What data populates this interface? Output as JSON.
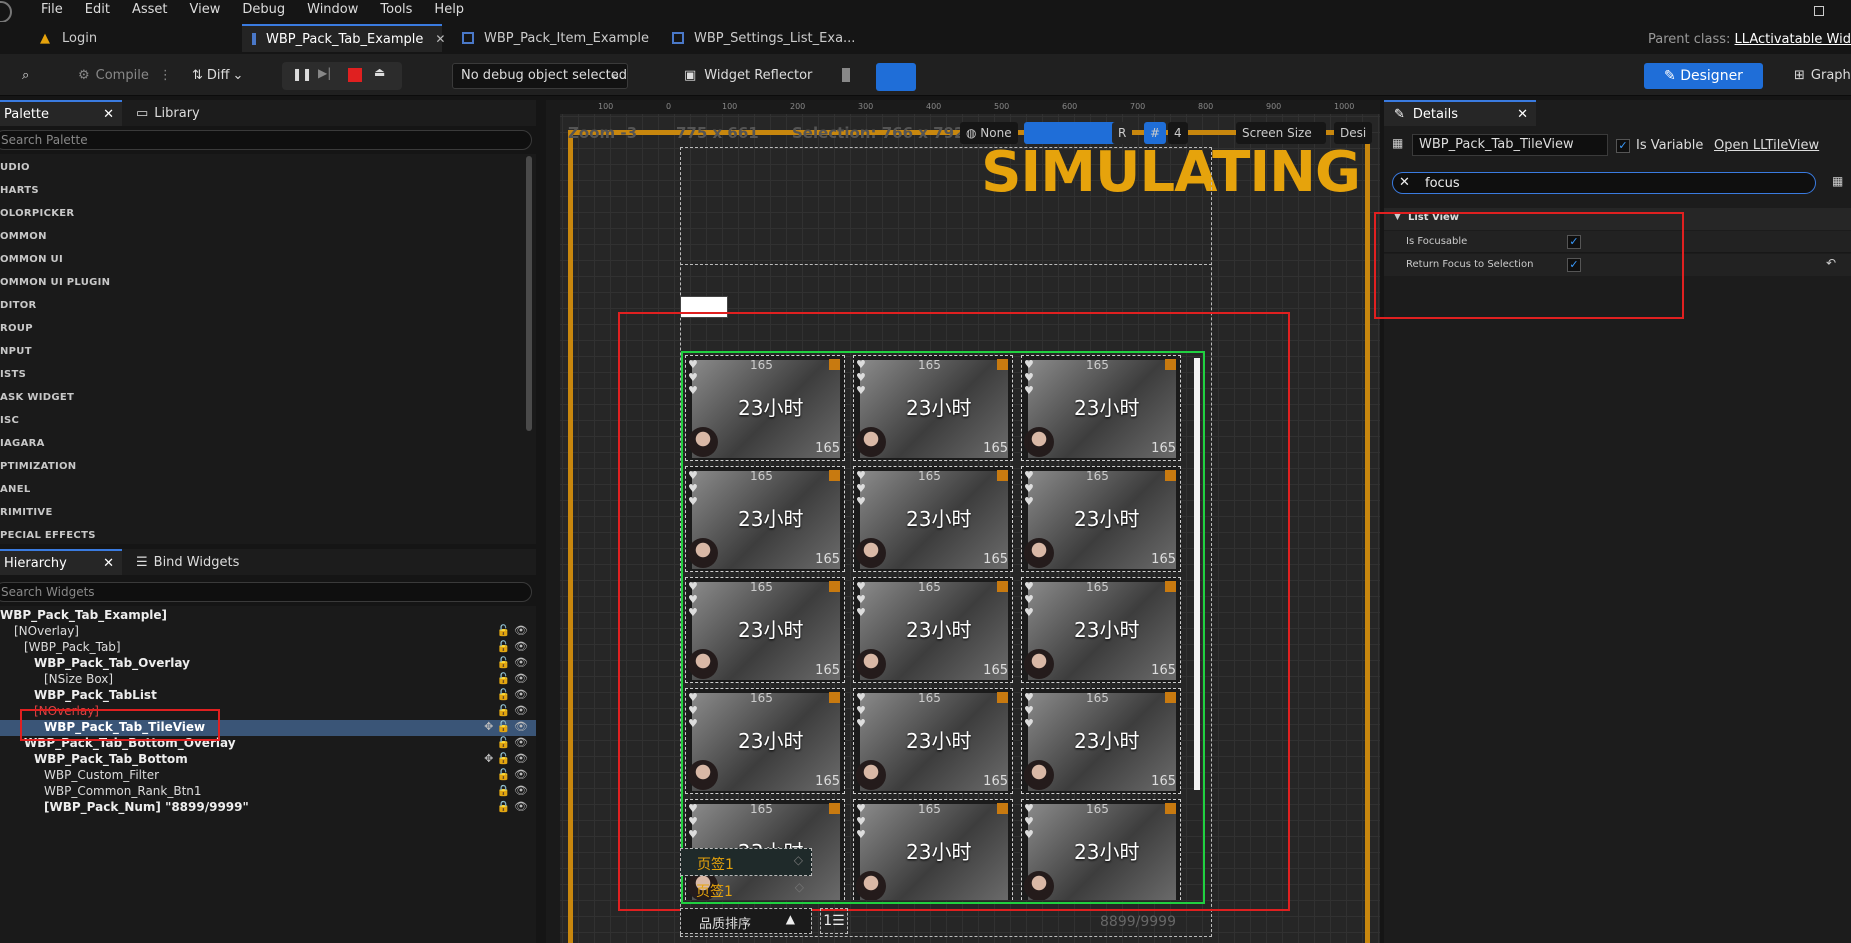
{
  "menu": [
    "File",
    "Edit",
    "Asset",
    "View",
    "Debug",
    "Window",
    "Tools",
    "Help"
  ],
  "tabs": [
    {
      "label": "Login",
      "active": false
    },
    {
      "label": "WBP_Pack_Tab_Example",
      "active": true
    },
    {
      "label": "WBP_Pack_Item_Example",
      "active": false
    },
    {
      "label": "WBP_Settings_List_Exa...",
      "active": false
    }
  ],
  "parent_class": {
    "label": "Parent class:",
    "value": "LLActivatable Wid"
  },
  "toolbar": {
    "compile": "Compile",
    "diff": "Diff",
    "debug_select": "No debug object selected",
    "widget_reflector": "Widget Reflector",
    "designer": "Designer",
    "graph": "Graph"
  },
  "palette": {
    "tab": "Palette",
    "library": "Library",
    "search_placeholder": "Search Palette",
    "categories": [
      "UDIO",
      "HARTS",
      "OLORPICKER",
      "OMMON",
      "OMMON UI",
      "OMMON UI PLUGIN",
      "DITOR",
      "ROUP",
      "NPUT",
      "ISTS",
      "ASK WIDGET",
      "ISC",
      "IAGARA",
      "PTIMIZATION",
      "ANEL",
      "RIMITIVE",
      "PECIAL EFFECTS"
    ]
  },
  "hierarchy": {
    "tab": "Hierarchy",
    "bind": "Bind Widgets",
    "search_placeholder": "Search Widgets",
    "items": [
      "WBP_Pack_Tab_Example]",
      "[NOverlay]",
      "[WBP_Pack_Tab]",
      "WBP_Pack_Tab_Overlay",
      "[NSize Box]",
      "WBP_Pack_TabList",
      "[NOverlay]",
      "WBP_Pack_Tab_TileView",
      "WBP_Pack_Tab_Bottom_Overlay",
      "WBP_Pack_Tab_Bottom",
      "WBP_Custom_Filter",
      "WBP_Common_Rank_Btn1",
      "[WBP_Pack_Num] \"8899/9999\""
    ]
  },
  "viewport": {
    "zoom": "Zoom -3",
    "size": "775 x 661",
    "selection": "Selection: 766 x 792",
    "none": "None",
    "r": "R",
    "four": "4",
    "screen_size": "Screen Size",
    "desi": "Desi",
    "simulating": "SIMULATING",
    "ruler": [
      "100",
      "0",
      "100",
      "200",
      "300",
      "400",
      "500",
      "600",
      "700",
      "800",
      "900",
      "1000"
    ],
    "tile_time": "23小时",
    "tile_num": "165",
    "tag": "页签1",
    "sort": "品质排序",
    "count": "8899/9999"
  },
  "details": {
    "tab": "Details",
    "widget_name": "WBP_Pack_Tab_TileView",
    "is_variable": "Is Variable",
    "open_link": "Open LLTileView",
    "search": "focus",
    "section": "List View",
    "props": [
      {
        "label": "Is Focusable",
        "checked": true
      },
      {
        "label": "Return Focus to Selection",
        "checked": true
      }
    ]
  }
}
